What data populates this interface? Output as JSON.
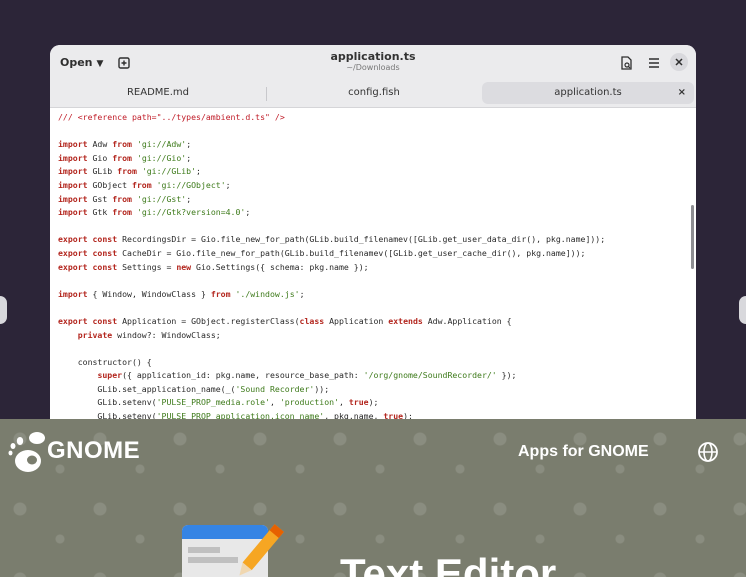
{
  "header": {
    "open_label": "Open",
    "title": "application.ts",
    "subtitle": "~/Downloads"
  },
  "tabs": [
    {
      "label": "README.md"
    },
    {
      "label": "config.fish"
    },
    {
      "label": "application.ts",
      "close": "×"
    }
  ],
  "code": [
    [
      [
        "cm",
        "/// <reference path=\"../types/ambient.d.ts\" />"
      ]
    ],
    [],
    [
      [
        "kw",
        "import"
      ],
      [
        "p",
        " Adw "
      ],
      [
        "kw",
        "from"
      ],
      [
        "p",
        " "
      ],
      [
        "str",
        "'gi://Adw'"
      ],
      [
        "p",
        ";"
      ]
    ],
    [
      [
        "kw",
        "import"
      ],
      [
        "p",
        " Gio "
      ],
      [
        "kw",
        "from"
      ],
      [
        "p",
        " "
      ],
      [
        "str",
        "'gi://Gio'"
      ],
      [
        "p",
        ";"
      ]
    ],
    [
      [
        "kw",
        "import"
      ],
      [
        "p",
        " GLib "
      ],
      [
        "kw",
        "from"
      ],
      [
        "p",
        " "
      ],
      [
        "str",
        "'gi://GLib'"
      ],
      [
        "p",
        ";"
      ]
    ],
    [
      [
        "kw",
        "import"
      ],
      [
        "p",
        " GObject "
      ],
      [
        "kw",
        "from"
      ],
      [
        "p",
        " "
      ],
      [
        "str",
        "'gi://GObject'"
      ],
      [
        "p",
        ";"
      ]
    ],
    [
      [
        "kw",
        "import"
      ],
      [
        "p",
        " Gst "
      ],
      [
        "kw",
        "from"
      ],
      [
        "p",
        " "
      ],
      [
        "str",
        "'gi://Gst'"
      ],
      [
        "p",
        ";"
      ]
    ],
    [
      [
        "kw",
        "import"
      ],
      [
        "p",
        " Gtk "
      ],
      [
        "kw",
        "from"
      ],
      [
        "p",
        " "
      ],
      [
        "str",
        "'gi://Gtk?version=4.0'"
      ],
      [
        "p",
        ";"
      ]
    ],
    [],
    [
      [
        "kw",
        "export const"
      ],
      [
        "p",
        " RecordingsDir = Gio.file_new_for_path(GLib.build_filenamev([GLib.get_user_data_dir(), pkg.name]));"
      ]
    ],
    [
      [
        "kw",
        "export const"
      ],
      [
        "p",
        " CacheDir = Gio.file_new_for_path(GLib.build_filenamev([GLib.get_user_cache_dir(), pkg.name]));"
      ]
    ],
    [
      [
        "kw",
        "export const"
      ],
      [
        "p",
        " Settings = "
      ],
      [
        "kw",
        "new"
      ],
      [
        "p",
        " Gio.Settings({ schema: pkg.name });"
      ]
    ],
    [],
    [
      [
        "kw",
        "import"
      ],
      [
        "p",
        " { Window, WindowClass } "
      ],
      [
        "kw",
        "from"
      ],
      [
        "p",
        " "
      ],
      [
        "str",
        "'./window.js'"
      ],
      [
        "p",
        ";"
      ]
    ],
    [],
    [
      [
        "kw",
        "export const"
      ],
      [
        "p",
        " Application = GObject.registerClass("
      ],
      [
        "kw",
        "class"
      ],
      [
        "p",
        " Application "
      ],
      [
        "kw",
        "extends"
      ],
      [
        "p",
        " Adw.Application {"
      ]
    ],
    [
      [
        "p",
        "    "
      ],
      [
        "kw",
        "private"
      ],
      [
        "p",
        " window?: WindowClass;"
      ]
    ],
    [],
    [
      [
        "p",
        "    constructor() {"
      ]
    ],
    [
      [
        "p",
        "        "
      ],
      [
        "kw",
        "super"
      ],
      [
        "p",
        "({ application_id: pkg.name, resource_base_path: "
      ],
      [
        "str",
        "'/org/gnome/SoundRecorder/'"
      ],
      [
        "p",
        " });"
      ]
    ],
    [
      [
        "p",
        "        GLib.set_application_name(_("
      ],
      [
        "str",
        "'Sound Recorder'"
      ],
      [
        "p",
        "));"
      ]
    ],
    [
      [
        "p",
        "        GLib.setenv("
      ],
      [
        "str",
        "'PULSE_PROP_media.role'"
      ],
      [
        "p",
        ", "
      ],
      [
        "str",
        "'production'"
      ],
      [
        "p",
        ", "
      ],
      [
        "kw",
        "true"
      ],
      [
        "p",
        ");"
      ]
    ],
    [
      [
        "p",
        "        GLib.setenv("
      ],
      [
        "str",
        "'PULSE_PROP_application.icon_name'"
      ],
      [
        "p",
        ", pkg.name, "
      ],
      [
        "kw",
        "true"
      ],
      [
        "p",
        ");"
      ]
    ]
  ],
  "banner": {
    "brand": "GNOME",
    "apps_link": "Apps for GNOME",
    "app_title": "Text Editor"
  },
  "icons": {
    "open_caret": "caret-down-icon",
    "new_tab": "new-tab-icon",
    "document": "document-icon",
    "menu": "hamburger-menu-icon",
    "close": "close-icon",
    "globe": "globe-icon"
  }
}
